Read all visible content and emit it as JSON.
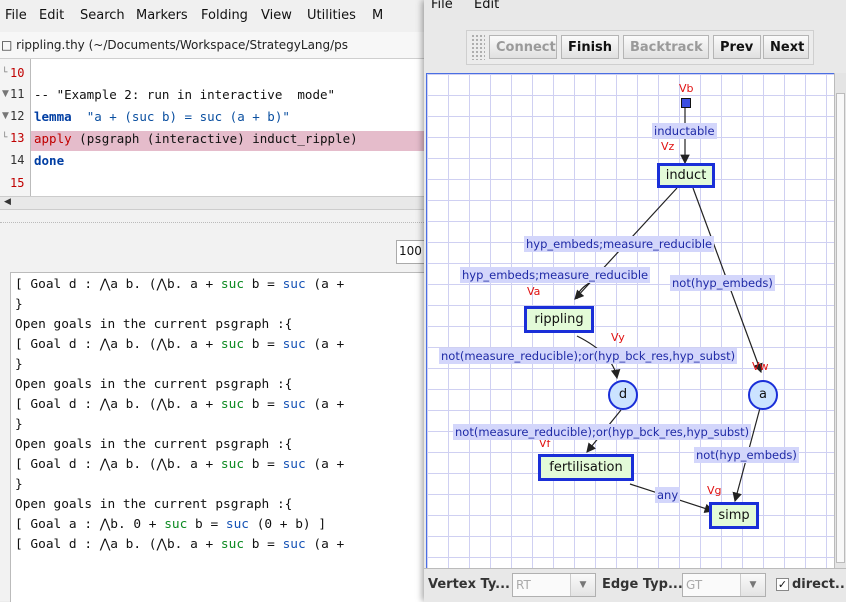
{
  "left_window": {
    "menu": [
      "File",
      "Edit",
      "Search",
      "Markers",
      "Folding",
      "View",
      "Utilities",
      "M"
    ],
    "path": "□ rippling.thy (~/Documents/Workspace/StrategyLang/ps",
    "lines": [
      {
        "num": "10",
        "fold": "└",
        "text": ""
      },
      {
        "num": "11",
        "fold": "▼",
        "text": "-- \"Example 2: run in interactive  mode\""
      },
      {
        "num": "12",
        "fold": "▼",
        "keyword": "lemma",
        "text": "  \"a + (suc b) = suc (a + b)\""
      },
      {
        "num": "13",
        "fold": "└",
        "keyword": "apply",
        "text": " (psgraph (interactive) induct_ripple)"
      },
      {
        "num": "14",
        "fold": "",
        "keyword": "done",
        "text": ""
      },
      {
        "num": "15",
        "fold": "",
        "text": ""
      }
    ],
    "zoom": "100",
    "output": {
      "goal_prefix": "[ Goal d : ⋀a b. (⋀b. a ",
      "goal_plus": "+ ",
      "goal_suc": "suc",
      "goal_mid": " b = ",
      "goal_tail": " (a +",
      "open_goals": "Open goals in the current psgraph :{",
      "close": "}",
      "goal_a_prefix": "[ Goal a : ⋀b. 0 ",
      "goal_a_mid": " b = ",
      "goal_a_tail": " (0 + b) ]"
    }
  },
  "right_window": {
    "menu": [
      "File",
      "Edit"
    ],
    "toolbar": {
      "connect": "Connect",
      "finish": "Finish",
      "backtrack": "Backtrack",
      "prev": "Prev",
      "next": "Next"
    },
    "graph": {
      "nodes": {
        "induct": "induct",
        "rippling": "rippling",
        "fertilisation": "fertilisation",
        "simp": "simp",
        "d": "d",
        "a": "a"
      },
      "vertex_names": {
        "vb": "Vb",
        "vz": "Vz",
        "va": "Va",
        "vy": "Vy",
        "vw": "Vw",
        "vf": "Vf",
        "vg": "Vg"
      },
      "edge_labels": {
        "e1": "inductable",
        "e2": "hyp_embeds;measure_reducible",
        "e3": "hyp_embeds;measure_reducible",
        "e4": "not(hyp_embeds)",
        "e5": "not(measure_reducible);or(hyp_bck_res,hyp_subst)",
        "e6": "not(measure_reducible);or(hyp_bck_res,hyp_subst)",
        "e7": "not(hyp_embeds)",
        "e8": "any"
      }
    },
    "bottom": {
      "vertex_type_label": "Vertex Ty...",
      "vertex_type_value": "RT",
      "edge_type_label": "Edge Typ...",
      "edge_type_value": "GT",
      "directed_label": "direct...",
      "directed_checked": "✓"
    }
  }
}
